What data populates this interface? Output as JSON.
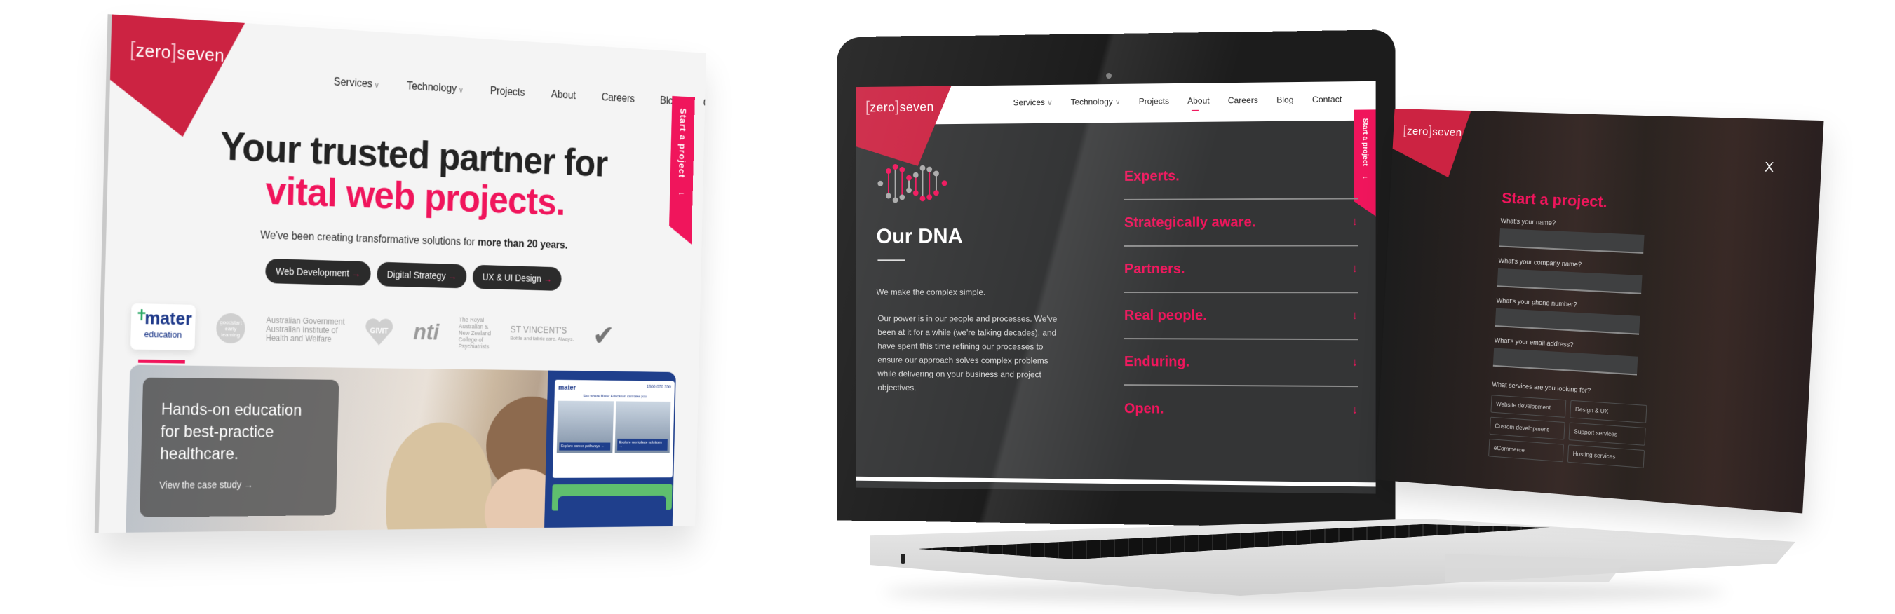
{
  "brand": {
    "logo_left_bracket": "[",
    "logo_word1": "zero",
    "logo_right_bracket": "]",
    "logo_word2": "seven",
    "accent_color": "#f0155c",
    "brand_red": "#cc2342",
    "dark_bg": "#343536"
  },
  "nav": {
    "items": [
      {
        "label": "Services",
        "has_dropdown": true
      },
      {
        "label": "Technology",
        "has_dropdown": true
      },
      {
        "label": "Projects",
        "has_dropdown": false
      },
      {
        "label": "About",
        "has_dropdown": false
      },
      {
        "label": "Careers",
        "has_dropdown": false
      },
      {
        "label": "Blog",
        "has_dropdown": false
      },
      {
        "label": "Contact",
        "has_dropdown": false
      }
    ],
    "dropdown_glyph": "∨",
    "start_project": "Start a project",
    "start_project_arrow": "←"
  },
  "home": {
    "headline_line1": "Your trusted partner for",
    "headline_line2": "vital web projects.",
    "subtitle_prefix": "We've been creating transformative solutions for ",
    "subtitle_bold": "more than 20 years.",
    "pills": [
      {
        "label": "Web Development",
        "arrow": "→"
      },
      {
        "label": "Digital Strategy",
        "arrow": "→"
      },
      {
        "label": "UX & UI Design",
        "arrow": "→"
      }
    ],
    "client_logos": {
      "mater_word": "mater",
      "mater_sub": "education",
      "mater_cross": "✝",
      "goodstart": "goodstart early learning",
      "aus_gov_line1": "Australian Government",
      "aus_gov_line2": "Australian Institute of",
      "aus_gov_line3": "Health and Welfare",
      "givit": "GIVIT",
      "nti": "nti",
      "ranzcp_line1": "The Royal",
      "ranzcp_line2": "Australian &",
      "ranzcp_line3": "New Zealand",
      "ranzcp_line4": "College of",
      "ranzcp_line5": "Psychiatrists",
      "stvincents_line1": "ST VINCENT'S",
      "stvincents_line2": "Bottle and fabric care. Always.",
      "check_glyph": "✔"
    },
    "case_study": {
      "title_line1": "Hands-on education",
      "title_line2": "for best-practice",
      "title_line3": "healthcare.",
      "link": "View the case study",
      "link_arrow": "→"
    },
    "phone_preview": {
      "logo": "mater",
      "phone": "1300 070 350",
      "tagline": "See where Mater Education can take you",
      "btn1": "Explore career pathways →",
      "btn2": "Explore workplace solutions →"
    }
  },
  "about": {
    "title": "Our DNA",
    "lead": "We make the complex simple.",
    "body": "Our power is in our people and processes. We've been at it for a while (we're talking decades), and have spent this time refining our processes to ensure our approach solves complex problems while delivering on your business and project objectives.",
    "values": [
      {
        "label": "Experts."
      },
      {
        "label": "Strategically aware."
      },
      {
        "label": "Partners."
      },
      {
        "label": "Real people."
      },
      {
        "label": "Enduring."
      },
      {
        "label": "Open."
      }
    ],
    "expand_glyph": "↓",
    "active_nav": "About"
  },
  "modal": {
    "close": "X",
    "title": "Start a project.",
    "fields": [
      {
        "label": "What's your name?",
        "value": ""
      },
      {
        "label": "What's your company name?",
        "value": ""
      },
      {
        "label": "What's your phone number?",
        "value": ""
      },
      {
        "label": "What's your email address?",
        "value": ""
      }
    ],
    "services_label": "What services are you looking for?",
    "services": [
      "Website development",
      "Design & UX",
      "Custom development",
      "Support services",
      "eCommerce",
      "Hosting services"
    ]
  }
}
